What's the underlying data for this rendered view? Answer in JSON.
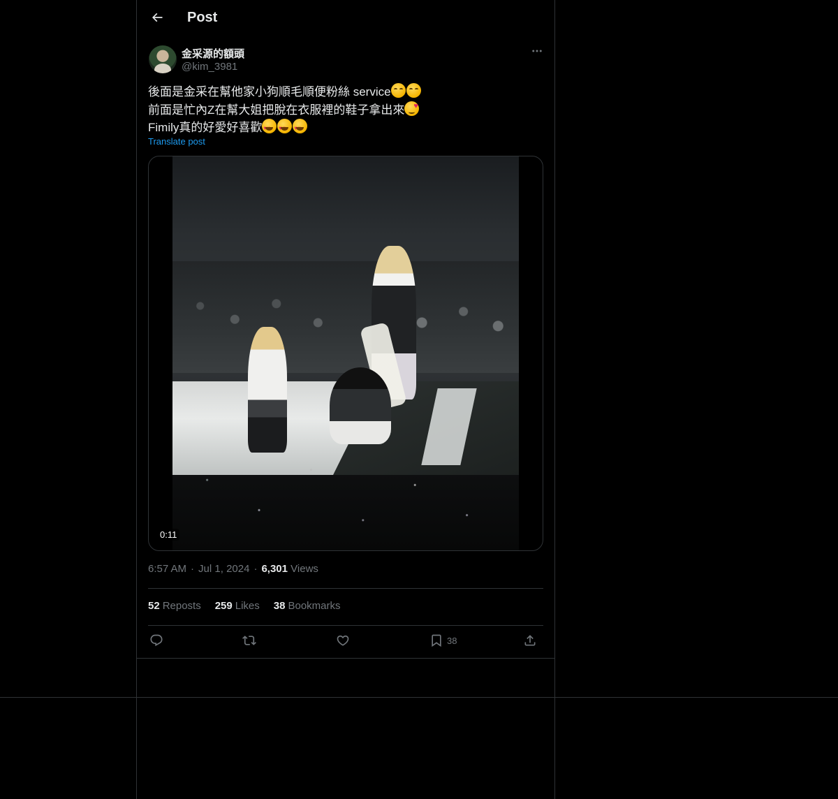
{
  "header": {
    "title": "Post",
    "back_icon": "arrow-left-icon"
  },
  "post": {
    "author": {
      "display_name": "金采源的額頭",
      "handle": "@kim_3981"
    },
    "text_lines": [
      {
        "text": "後面是金采在幫他家小狗順毛順便粉絲 service",
        "emojis": [
          "kissing-face-icon",
          "kissing-face-icon"
        ]
      },
      {
        "text": "前面是忙內Z在幫大姐把脫在衣服裡的鞋子拿出來",
        "emojis": [
          "smiling-face-with-hearts-icon"
        ]
      },
      {
        "text": "Fimily真的好愛好喜歡",
        "emojis": [
          "heart-eyes-icon",
          "heart-eyes-icon",
          "heart-eyes-icon"
        ]
      }
    ],
    "translate_label": "Translate post",
    "video": {
      "duration": "0:11"
    },
    "meta": {
      "time": "6:57 AM",
      "date": "Jul 1, 2024",
      "views_count": "6,301",
      "views_label": "Views",
      "separator": "·"
    },
    "stats": {
      "reposts": {
        "count": "52",
        "label": "Reposts"
      },
      "likes": {
        "count": "259",
        "label": "Likes"
      },
      "bookmarks": {
        "count": "38",
        "label": "Bookmarks"
      }
    },
    "actions": {
      "reply_icon": "reply-icon",
      "repost_icon": "repost-icon",
      "like_icon": "heart-icon",
      "bookmark_icon": "bookmark-icon",
      "bookmark_count": "38",
      "share_icon": "share-icon"
    }
  },
  "colors": {
    "background": "#000000",
    "text": "#e7e9ea",
    "muted": "#71767b",
    "border": "#2f3336",
    "link": "#1d9bf0"
  }
}
